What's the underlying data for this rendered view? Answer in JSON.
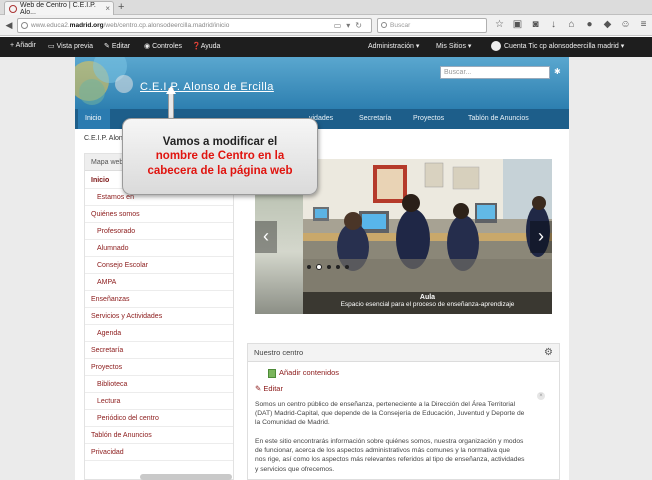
{
  "browser": {
    "tab_title": "Web de Centro | C.E.I.P. Alo...",
    "url_prefix": "www.educa2.",
    "url_domain": "madrid.org",
    "url_path": "/web/centro.cp.alonsodeercilla.madrid/inicio",
    "search_placeholder": "Buscar",
    "new_tab": "+",
    "tab_close": "×"
  },
  "dockbar": {
    "add": "+ Añadir",
    "preview": "Vista previa",
    "edit": "Editar",
    "controls": "Controles",
    "help": "Ayuda",
    "admin": "Administración",
    "my_sites": "Mis Sitios",
    "user": "Cuenta Tic cp alonsodeercilla madrid"
  },
  "header": {
    "site_title": "C.E.I.P. Alonso de Ercilla",
    "search_placeholder": "Buscar..."
  },
  "nav": {
    "items": [
      "Inicio",
      "Quiénes somos",
      "Enseñanzas",
      "Servicios y Actividades",
      "Secretaría",
      "Proyectos",
      "Tablón de Anuncios"
    ],
    "visible_partial": "vidades"
  },
  "breadcrumb": "C.E.I.P. Alonso",
  "sidebar": {
    "title": "Mapa web",
    "items": [
      "Inicio",
      "Estamos en",
      "Quiénes somos",
      "Profesorado",
      "Alumnado",
      "Consejo Escolar",
      "AMPA",
      "Enseñanzas",
      "Servicios y Actividades",
      "Agenda",
      "Secretaría",
      "Proyectos",
      "Biblioteca",
      "Lectura",
      "Periódico del centro",
      "Tablón de Anuncios",
      "Privacidad"
    ]
  },
  "carousel": {
    "caption_title": "Aula",
    "caption_text": "Espacio esencial para el proceso de enseñanza-aprendizaje",
    "prev": "‹",
    "next": "›",
    "slide_count": 5,
    "selected_slide": 2
  },
  "portlet": {
    "title": "Nuestro centro",
    "add_content": "Añadir contenidos",
    "edit": "Editar",
    "paragraph1": [
      "Somos un centro público de enseñanza, perteneciente a la Dirección del Área Territorial",
      "(DAT) Madrid-Capital, que depende de la Consejería de Educación, Juventud y Deporte de",
      "la Comunidad de Madrid."
    ],
    "paragraph2": [
      "En este sitio encontrarás información sobre quiénes somos, nuestra organización y modos",
      "de funcionar, acerca de los aspectos administrativos más comunes y la normativa que",
      "nos rige, así como los aspectos más relevantes referidos al tipo de enseñanza, actividades",
      "y servicios que ofrecemos."
    ]
  },
  "callout": {
    "line1": "Vamos a modificar el",
    "line2": "nombre de Centro en la",
    "line3": "cabecera de la página web"
  },
  "colors": {
    "header_blue": "#2d7fb0",
    "nav_blue": "#1d5e8a",
    "link_red": "#8b1a1a",
    "callout_red": "#e0140f"
  }
}
